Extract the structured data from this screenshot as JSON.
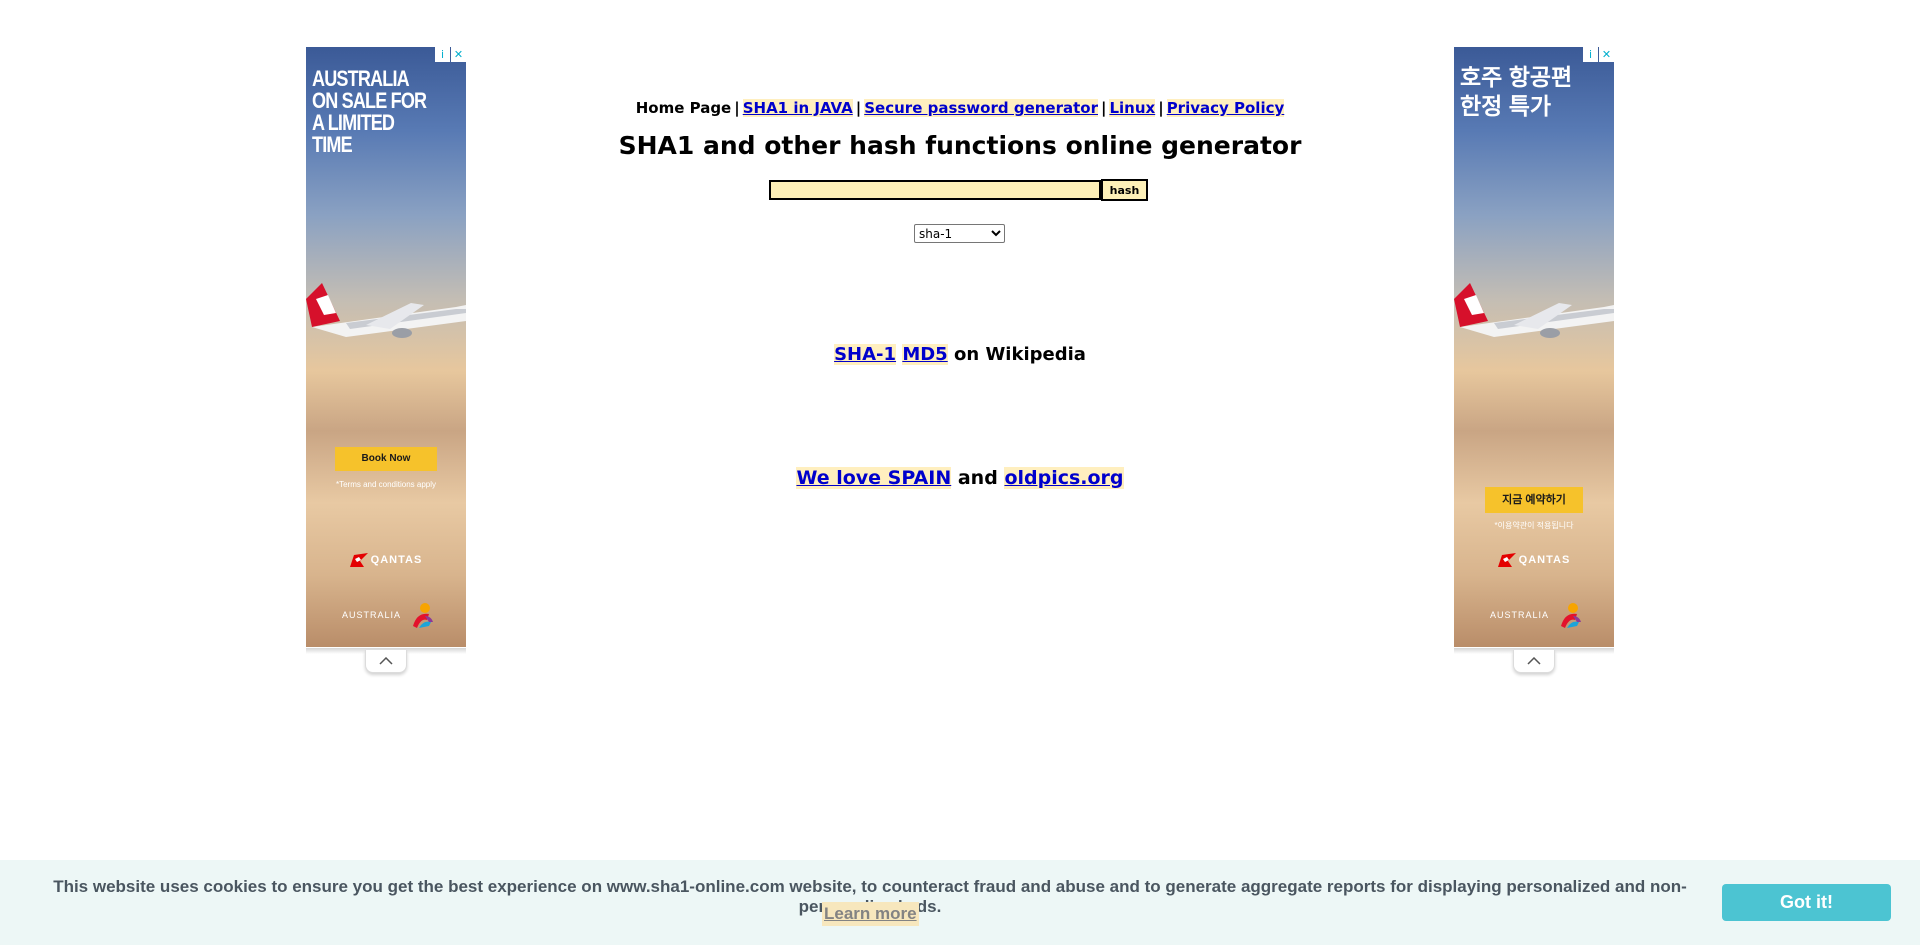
{
  "nav": {
    "home": "Home Page",
    "separator": "|",
    "links": [
      "SHA1 in JAVA",
      "Secure password generator",
      "Linux",
      "Privacy Policy"
    ]
  },
  "title": "SHA1 and other hash functions online generator",
  "hash_form": {
    "input_value": "",
    "button_label": "hash",
    "algorithm_selected": "sha-1"
  },
  "wiki": {
    "link1": "SHA-1",
    "link2": "MD5",
    "suffix": "on Wikipedia"
  },
  "promo": {
    "link1": "We love SPAIN",
    "conjunction": "and",
    "link2": "oldpics.org"
  },
  "ad_left": {
    "headline": "AUSTRALIA\nON SALE FOR\nA LIMITED TIME",
    "cta": "Book Now",
    "terms": "*Terms and conditions apply",
    "brand": "QANTAS",
    "country": "AUSTRALIA",
    "info_icon": "i",
    "close_icon": "✕"
  },
  "ad_right": {
    "headline": "호주 항공편\n한정 특가",
    "cta": "지금 예약하기",
    "terms": "*이용약관이 적용됩니다",
    "brand": "QANTAS",
    "country": "AUSTRALIA",
    "info_icon": "i",
    "close_icon": "✕"
  },
  "cookie": {
    "message": "This website uses cookies to ensure you get the best experience on www.sha1-online.com website, to counteract fraud and abuse and to generate aggregate reports for displaying personalized and non-personalized ads.",
    "learn_more": "Learn more",
    "accept": "Got it!"
  },
  "colors": {
    "link": "#0000cc",
    "link_highlight": "#ffefbf",
    "input_background": "#fdf0b8",
    "cookie_bar": "#edf7f6",
    "accept_button": "#4cc4d2",
    "ad_cta": "#f6c22b",
    "ad_info": "#00aecd"
  }
}
